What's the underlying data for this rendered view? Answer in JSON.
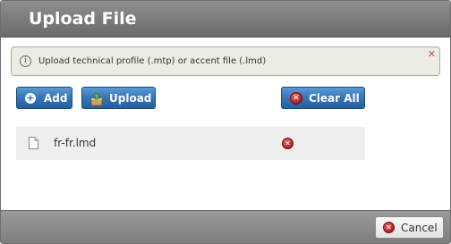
{
  "dialog": {
    "title": "Upload File"
  },
  "info": {
    "icon": "info-icon",
    "message": "Upload technical profile (.mtp) or accent file (.lmd)",
    "close_glyph": "x"
  },
  "toolbar": {
    "add_label": "Add",
    "upload_label": "Upload",
    "clear_all_label": "Clear All"
  },
  "files": [
    {
      "name": "fr-fr.lmd",
      "icon": "file-icon",
      "remove_icon": "remove-icon"
    }
  ],
  "footer": {
    "cancel_label": "Cancel"
  },
  "colors": {
    "titlebar": "#7a7a7a",
    "primary_button": "#3475b8",
    "danger": "#b01c1c",
    "info_background": "#ecebe4"
  }
}
